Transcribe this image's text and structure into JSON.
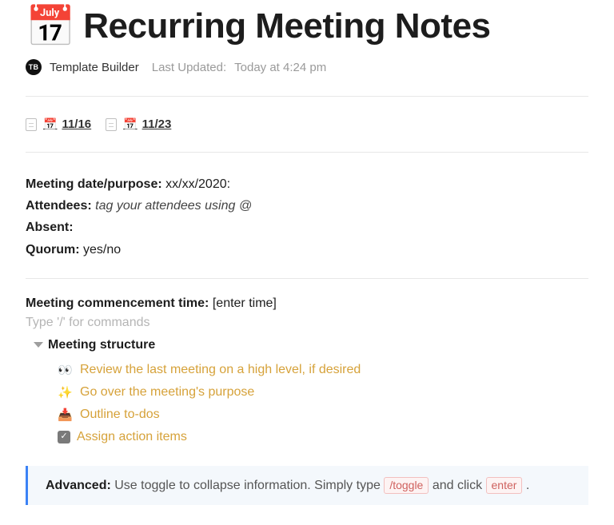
{
  "header": {
    "icon": "📅",
    "icon_calendar_day": "17",
    "title": "Recurring Meeting Notes"
  },
  "byline": {
    "avatar_initials": "TB",
    "author": "Template Builder",
    "updated_label": "Last Updated:",
    "updated_value": "Today at 4:24 pm"
  },
  "subpages": [
    {
      "emoji": "📅",
      "label": "11/16"
    },
    {
      "emoji": "📅",
      "label": "11/23"
    }
  ],
  "fields": {
    "date_purpose": {
      "label": "Meeting date/purpose:",
      "value": "xx/xx/2020:"
    },
    "attendees": {
      "label": "Attendees:",
      "value": "tag your attendees using @"
    },
    "absent": {
      "label": "Absent:",
      "value": ""
    },
    "quorum": {
      "label": "Quorum:",
      "value": "yes/no"
    }
  },
  "commencement": {
    "label": "Meeting commencement time:",
    "value": "[enter time]"
  },
  "slash_placeholder": "Type '/' for commands",
  "toggle": {
    "title": "Meeting structure",
    "items": [
      {
        "emoji": "👀",
        "text": "Review the last meeting on a high level, if desired"
      },
      {
        "emoji": "✨",
        "text": "Go over the meeting's purpose"
      },
      {
        "emoji": "📥",
        "text": "Outline to-dos"
      },
      {
        "emoji": "checkbox",
        "text": "Assign action items"
      }
    ]
  },
  "callout": {
    "lead": "Advanced:",
    "text_before": "Use toggle to collapse information. Simply type",
    "kbd_1": "/toggle",
    "text_middle": "and click",
    "kbd_2": "enter",
    "text_after": "."
  }
}
